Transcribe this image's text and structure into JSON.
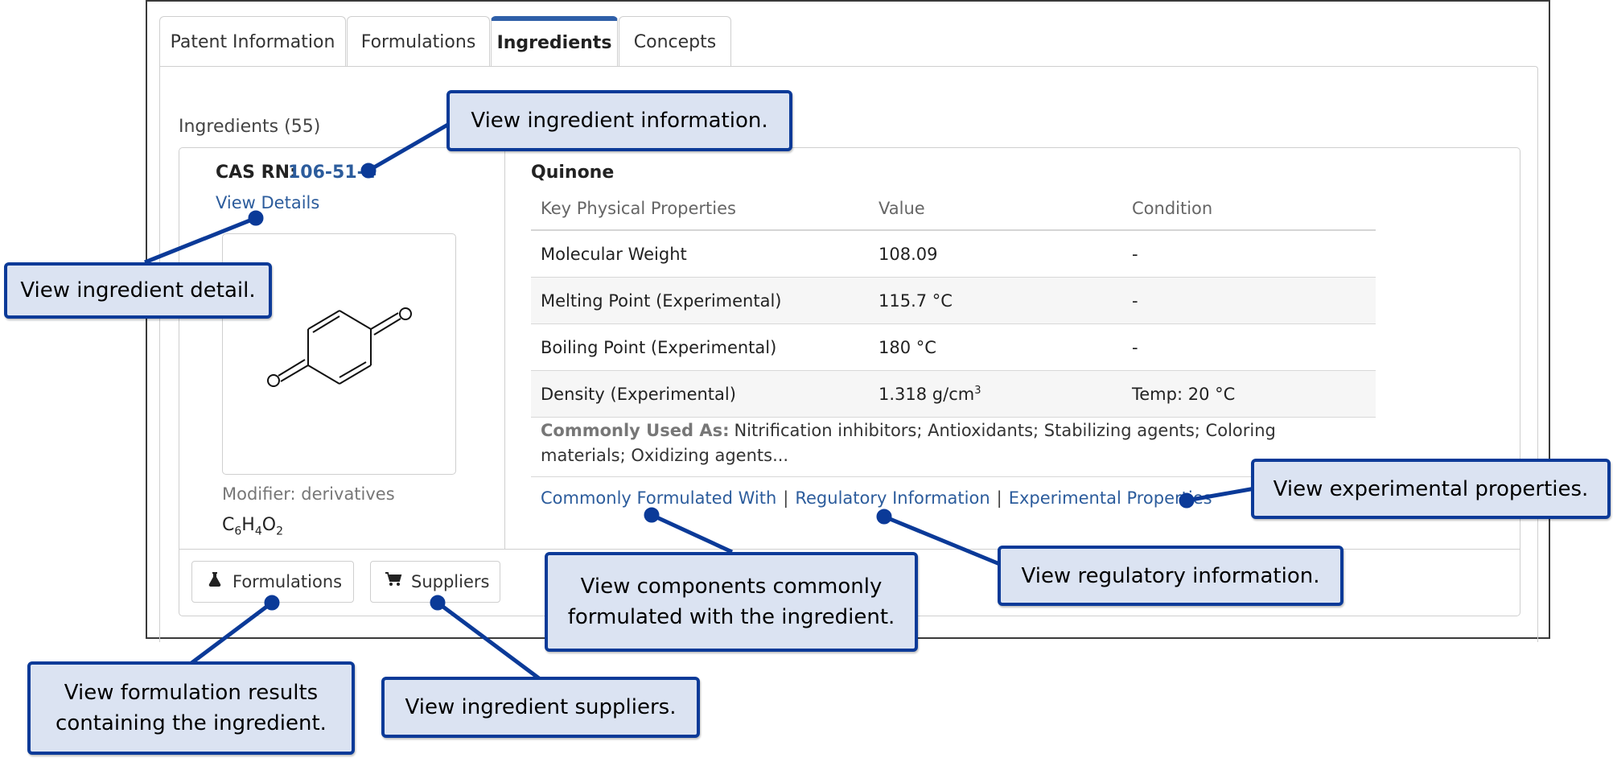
{
  "tabs": [
    "Patent Information",
    "Formulations",
    "Ingredients",
    "Concepts"
  ],
  "ingredients_header": "Ingredients (55)",
  "ingredient": {
    "cas_label": "CAS RN:",
    "cas_value": "106-51-4",
    "view_details": "View Details",
    "modifier": "Modifier: derivatives",
    "formula_parts": [
      "C",
      "6",
      "H",
      "4",
      "O",
      "2"
    ],
    "name": "Quinone",
    "table_headers": [
      "Key Physical Properties",
      "Value",
      "Condition"
    ],
    "rows": [
      [
        "Molecular Weight",
        "108.09",
        "-"
      ],
      [
        "Melting Point (Experimental)",
        "115.7 °C",
        "-"
      ],
      [
        "Boiling Point (Experimental)",
        "180 °C",
        "-"
      ],
      [
        "Density (Experimental)",
        "1.318 g/cm",
        "Temp: 20 °C"
      ]
    ],
    "density_sup": "3",
    "used_as_label": "Commonly Used As:",
    "used_as_text": "Nitrification inhibitors; Antioxidants; Stabilizing agents; Coloring materials; Oxidizing agents...",
    "links": [
      "Commonly Formulated With",
      "Regulatory Information",
      "Experimental Properties"
    ],
    "link_sep": "|"
  },
  "buttons": {
    "formulations": "Formulations",
    "suppliers": "Suppliers"
  },
  "callouts": {
    "ingredient_info": "View ingredient information.",
    "ingredient_detail": "View ingredient detail.",
    "experimental": "View experimental properties.",
    "regulatory": "View regulatory information.",
    "formulated_with": "View components commonly formulated with the ingredient.",
    "formulation_results": "View formulation results containing the ingredient.",
    "suppliers": "View ingredient suppliers."
  },
  "colors": {
    "link": "#2c5c9c",
    "callout_border": "#0b3a98",
    "callout_fill": "#dbe3f2",
    "tab_active": "#2f5fa8"
  }
}
